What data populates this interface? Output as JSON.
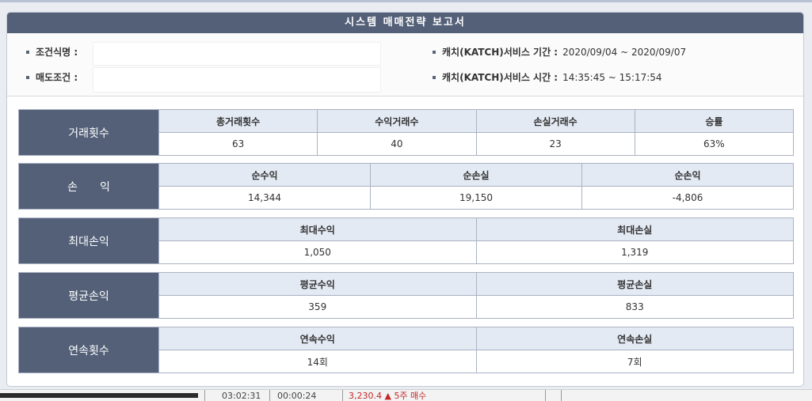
{
  "title": "시스템 매매전략 보고서",
  "info": {
    "condition_name_label": "조건식명 :",
    "condition_name_value": "",
    "sell_condition_label": "매도조건 :",
    "sell_condition_value": "",
    "period_label": "캐치(KATCH)서비스 기간 :",
    "period_value": "2020/09/04 ~ 2020/09/07",
    "time_label": "캐치(KATCH)서비스 시간 :",
    "time_value": "14:35:45 ~ 15:17:54"
  },
  "trades": {
    "label": "거래횟수",
    "headers": [
      "총거래횟수",
      "수익거래수",
      "손실거래수",
      "승률"
    ],
    "values": [
      "63",
      "40",
      "23",
      "63%"
    ]
  },
  "pnl": {
    "label": "손　　익",
    "headers": [
      "순수익",
      "순손실",
      "순손익"
    ],
    "values": [
      "14,344",
      "19,150",
      "-4,806"
    ]
  },
  "max_pnl": {
    "label": "최대손익",
    "headers": [
      "최대수익",
      "최대손실"
    ],
    "values": [
      "1,050",
      "1,319"
    ]
  },
  "avg_pnl": {
    "label": "평균손익",
    "headers": [
      "평균수익",
      "평균손실"
    ],
    "values": [
      "359",
      "833"
    ]
  },
  "streak": {
    "label": "연속횟수",
    "headers": [
      "연속수익",
      "연속손실"
    ],
    "values": [
      "14회",
      "7회"
    ]
  },
  "taskbar": {
    "time_text": "03:02:31",
    "item_text": "00:00:24",
    "status_text": "3,230.4 ▲ 5주 매수"
  },
  "colors": {
    "header_bg": "#536078",
    "column_header_bg": "#e4eaf4",
    "profit": "#c2185b",
    "loss": "#1565c0"
  }
}
